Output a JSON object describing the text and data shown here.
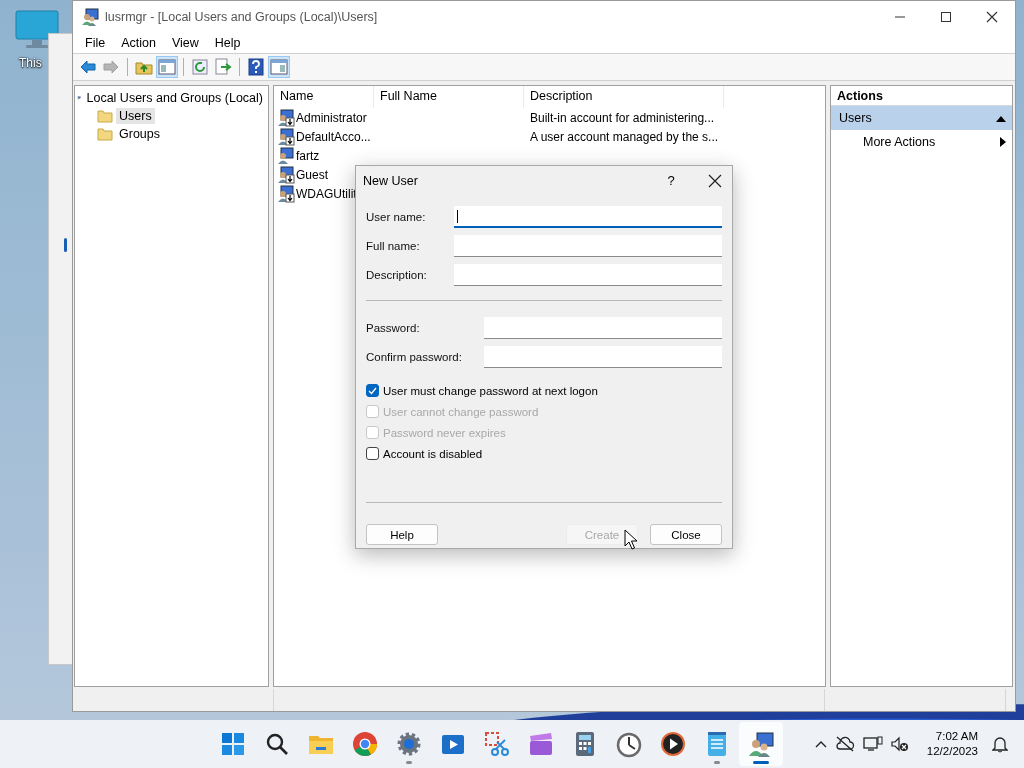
{
  "desktop": {
    "icon_label": "This"
  },
  "window": {
    "title": "lusrmgr - [Local Users and Groups (Local)\\Users]"
  },
  "menu": [
    "File",
    "Action",
    "View",
    "Help"
  ],
  "toolbar": [
    {
      "pressed": false,
      "disabled": false
    },
    {
      "pressed": false,
      "disabled": true
    },
    {
      "pressed": false,
      "disabled": false
    },
    {
      "pressed": true,
      "disabled": false
    },
    {
      "pressed": false,
      "disabled": false
    },
    {
      "pressed": false,
      "disabled": false
    },
    {
      "pressed": false,
      "disabled": false
    },
    {
      "pressed": true,
      "disabled": false
    }
  ],
  "tree": {
    "label": "Local Users and Groups (Local)",
    "selected": false,
    "children": [
      {
        "label": "Users",
        "selected": true
      },
      {
        "label": "Groups",
        "selected": false
      }
    ]
  },
  "table": {
    "columns": [
      "Name",
      "Full Name",
      "Description"
    ],
    "rows": [
      {
        "name": "Administrator",
        "description": "Built-in account for administering...",
        "disabled": true
      },
      {
        "name": "DefaultAcco...",
        "description": "A user account managed by the s...",
        "disabled": true
      },
      {
        "name": "fartz",
        "disabled": false
      },
      {
        "name": "Guest",
        "disabled": true
      },
      {
        "name": "WDAGUtilit",
        "disabled": true
      }
    ]
  },
  "actions": {
    "title": "Actions",
    "section": {
      "label": "Users",
      "expanded": true
    },
    "items": [
      "More Actions"
    ]
  },
  "dialog": {
    "title": "New User",
    "help": "?",
    "account_fields": [
      {
        "label": "User name:",
        "focused": true
      },
      {
        "label": "Full name:",
        "focused": false
      },
      {
        "label": "Description:",
        "focused": false
      }
    ],
    "password_fields": [
      {
        "label": "Password:",
        "focused": false
      },
      {
        "label": "Confirm password:",
        "focused": false
      }
    ],
    "checkboxes": [
      {
        "label": "User must change password at next logon",
        "checked": true,
        "disabled": false
      },
      {
        "label": "User cannot change password",
        "checked": false,
        "disabled": true
      },
      {
        "label": "Password never expires",
        "checked": false,
        "disabled": true
      },
      {
        "label": "Account is disabled",
        "checked": false,
        "disabled": false
      }
    ],
    "buttons": [
      {
        "label": "Help",
        "disabled": false
      },
      {
        "label": "Create",
        "disabled": true
      },
      {
        "label": "Close",
        "disabled": false
      }
    ]
  },
  "taskbar": {
    "apps": [
      {
        "running": false,
        "selected": false
      },
      {
        "running": false,
        "selected": false
      },
      {
        "running": false,
        "selected": false
      },
      {
        "running": false,
        "selected": false
      },
      {
        "running": true,
        "selected": false
      },
      {
        "running": false,
        "selected": false
      },
      {
        "running": false,
        "selected": false
      },
      {
        "running": false,
        "selected": false
      },
      {
        "running": false,
        "selected": false
      },
      {
        "running": false,
        "selected": false
      },
      {
        "running": false,
        "selected": false
      },
      {
        "running": true,
        "selected": false
      },
      {
        "running": true,
        "selected": true
      }
    ],
    "time": "7:02 AM",
    "date": "12/2/2023"
  }
}
